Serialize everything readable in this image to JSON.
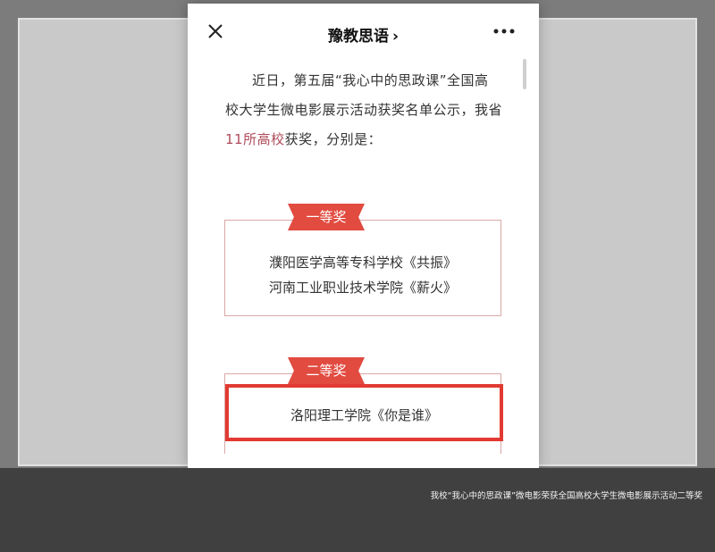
{
  "header": {
    "title": "豫教思语",
    "chevron": "›"
  },
  "intro": {
    "line1": "近日，第五届“我心中的思政课”全国高",
    "line2": "校大学生微电影展示活动获奖名单公示，我省",
    "highlight": "11所高校",
    "line3_rest": "获奖，分别是："
  },
  "awards": {
    "first": {
      "label": "一等奖",
      "items": [
        "濮阳医学高等专科学校《共振》",
        "河南工业职业技术学院《薪火》"
      ]
    },
    "second": {
      "label": "二等奖",
      "items": [
        "洛阳理工学院《你是谁》"
      ]
    }
  },
  "caption": "我校“我心中的思政课”微电影荣获全国高校大学生微电影展示活动二等奖",
  "icons": [
    "close-icon",
    "more-icon",
    "chevron-right-icon"
  ],
  "colors": {
    "ribbon": "#e24b40",
    "highlight_border": "#e23a32",
    "link_text": "#b04a5a",
    "award_border": "#d9a9a6"
  }
}
